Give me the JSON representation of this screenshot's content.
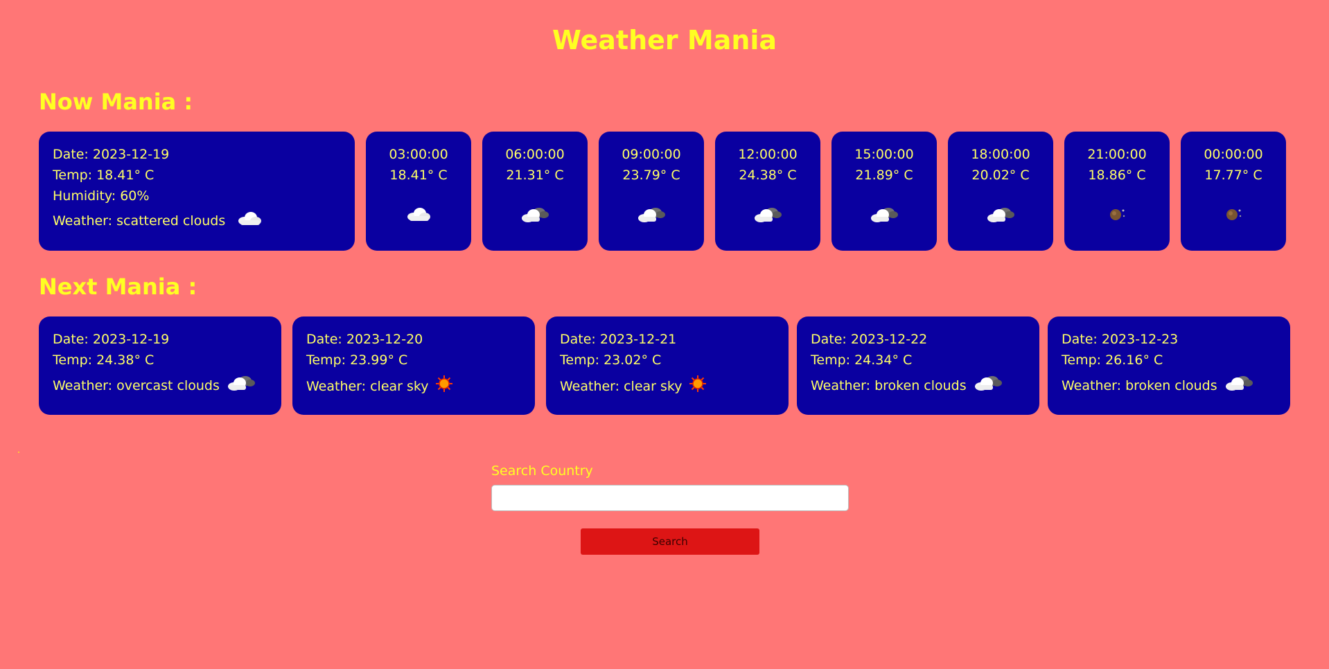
{
  "header": {
    "title": "Weather Mania"
  },
  "now": {
    "section_title": "Now Mania :",
    "current": {
      "date": "Date: 2023-12-19",
      "temp": "Temp: 18.41° C",
      "humidity": "Humidity: 60%",
      "weather": "Weather: scattered clouds",
      "icon": "cloud-icon"
    },
    "hourly": [
      {
        "time": "03:00:00",
        "temp": "18.41° C",
        "icon": "cloud-icon"
      },
      {
        "time": "06:00:00",
        "temp": "21.31° C",
        "icon": "cloudy-icon"
      },
      {
        "time": "09:00:00",
        "temp": "23.79° C",
        "icon": "cloudy-icon"
      },
      {
        "time": "12:00:00",
        "temp": "24.38° C",
        "icon": "cloudy-icon"
      },
      {
        "time": "15:00:00",
        "temp": "21.89° C",
        "icon": "cloudy-icon"
      },
      {
        "time": "18:00:00",
        "temp": "20.02° C",
        "icon": "cloudy-icon"
      },
      {
        "time": "21:00:00",
        "temp": "18.86° C",
        "icon": "night-icon"
      },
      {
        "time": "00:00:00",
        "temp": "17.77° C",
        "icon": "night-icon"
      }
    ]
  },
  "next": {
    "section_title": "Next Mania :",
    "days": [
      {
        "date": "Date: 2023-12-19",
        "temp": "Temp: 24.38° C",
        "weather": "Weather: overcast clouds",
        "icon": "cloudy-icon"
      },
      {
        "date": "Date: 2023-12-20",
        "temp": "Temp: 23.99° C",
        "weather": "Weather: clear sky",
        "icon": "sun-icon"
      },
      {
        "date": "Date: 2023-12-21",
        "temp": "Temp: 23.02° C",
        "weather": "Weather: clear sky",
        "icon": "sun-icon"
      },
      {
        "date": "Date: 2023-12-22",
        "temp": "Temp: 24.34° C",
        "weather": "Weather: broken clouds",
        "icon": "cloudy-icon"
      },
      {
        "date": "Date: 2023-12-23",
        "temp": "Temp: 26.16° C",
        "weather": "Weather: broken clouds",
        "icon": "cloudy-icon"
      }
    ]
  },
  "search": {
    "label": "Search Country",
    "value": "",
    "placeholder": "",
    "button_label": "Search"
  },
  "colors": {
    "background": "#ff7676",
    "card": "#0a00a0",
    "title": "#ffff22",
    "card_text": "#ffff66",
    "button": "#dd1515"
  }
}
